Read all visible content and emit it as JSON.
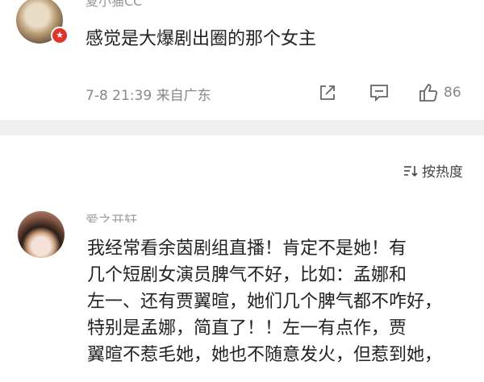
{
  "comment_1": {
    "username": "夏小猫CC",
    "text": "感觉是大爆剧出圈的那个女主",
    "meta": "7-8 21:39 来自广东",
    "like_count": "86"
  },
  "sort": {
    "label": "按热度"
  },
  "comment_2": {
    "username": "爱之开轩",
    "lines": [
      "我经常看余茵剧组直播！肯定不是她！有",
      "几个短剧女演员脾气不好，比如：孟娜和",
      "左一、还有贾翼暄，她们几个脾气都不咋好，",
      "特别是孟娜，简直了！！左一有点作，贾",
      "翼暄不惹毛她，她也不随意发火，但惹到她，"
    ]
  },
  "colors": {
    "badge": "#e0332c",
    "separator": "#efefef",
    "meta_text": "#888888"
  },
  "icons": [
    "vip-badge-icon",
    "share-icon",
    "reply-icon",
    "like-icon",
    "sort-icon"
  ]
}
